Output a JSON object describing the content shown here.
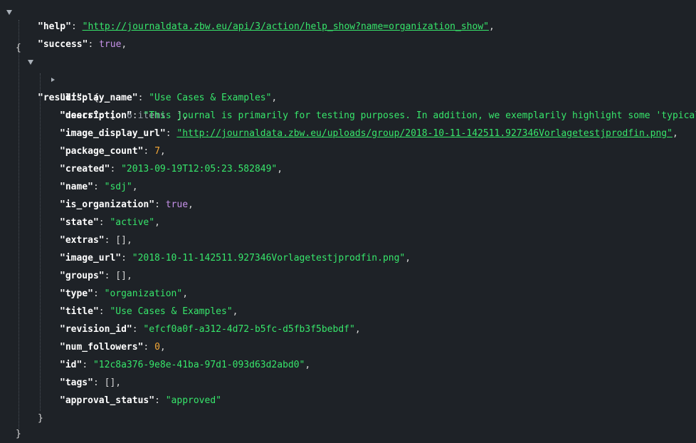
{
  "colors": {
    "background": "#1e2227",
    "key": "#ffffff",
    "string": "#37e66b",
    "boolean": "#c792ea",
    "number": "#f3a736",
    "punctuation": "#d6d6d6"
  },
  "icons": {
    "expanded": "caret-down-icon",
    "collapsed": "caret-right-icon"
  },
  "json": {
    "root_open": "{",
    "root_close": "}",
    "help": {
      "key": "\"help\"",
      "value": "\"http://journaldata.zbw.eu/api/3/action/help_show?name=organization_show\""
    },
    "success": {
      "key": "\"success\"",
      "value": "true"
    },
    "result": {
      "key": "\"result\"",
      "open": "{",
      "close": "}",
      "users": {
        "key": "\"users\"",
        "bracket_open": "[",
        "count": "6 items",
        "bracket_close": "],"
      },
      "display_name": {
        "key": "\"display_name\"",
        "value": "\"Use Cases & Examples\""
      },
      "description": {
        "key": "\"description\"",
        "value": "\"This journal is primarily for testing purposes. In addition, we exemplarily highlight some 'typical'"
      },
      "image_display_url": {
        "key": "\"image_display_url\"",
        "value": "\"http://journaldata.zbw.eu/uploads/group/2018-10-11-142511.927346Vorlagetestjprodfin.png\""
      },
      "package_count": {
        "key": "\"package_count\"",
        "value": "7"
      },
      "created": {
        "key": "\"created\"",
        "value": "\"2013-09-19T12:05:23.582849\""
      },
      "name": {
        "key": "\"name\"",
        "value": "\"sdj\""
      },
      "is_organization": {
        "key": "\"is_organization\"",
        "value": "true"
      },
      "state": {
        "key": "\"state\"",
        "value": "\"active\""
      },
      "extras": {
        "key": "\"extras\"",
        "value": "[]"
      },
      "image_url": {
        "key": "\"image_url\"",
        "value": "\"2018-10-11-142511.927346Vorlagetestjprodfin.png\""
      },
      "groups": {
        "key": "\"groups\"",
        "value": "[]"
      },
      "type": {
        "key": "\"type\"",
        "value": "\"organization\""
      },
      "title": {
        "key": "\"title\"",
        "value": "\"Use Cases & Examples\""
      },
      "revision_id": {
        "key": "\"revision_id\"",
        "value": "\"efcf0a0f-a312-4d72-b5fc-d5fb3f5bebdf\""
      },
      "num_followers": {
        "key": "\"num_followers\"",
        "value": "0"
      },
      "id": {
        "key": "\"id\"",
        "value": "\"12c8a376-9e8e-41ba-97d1-093d63d2abd0\""
      },
      "tags": {
        "key": "\"tags\"",
        "value": "[]"
      },
      "approval_status": {
        "key": "\"approval_status\"",
        "value": "\"approved\""
      }
    }
  }
}
